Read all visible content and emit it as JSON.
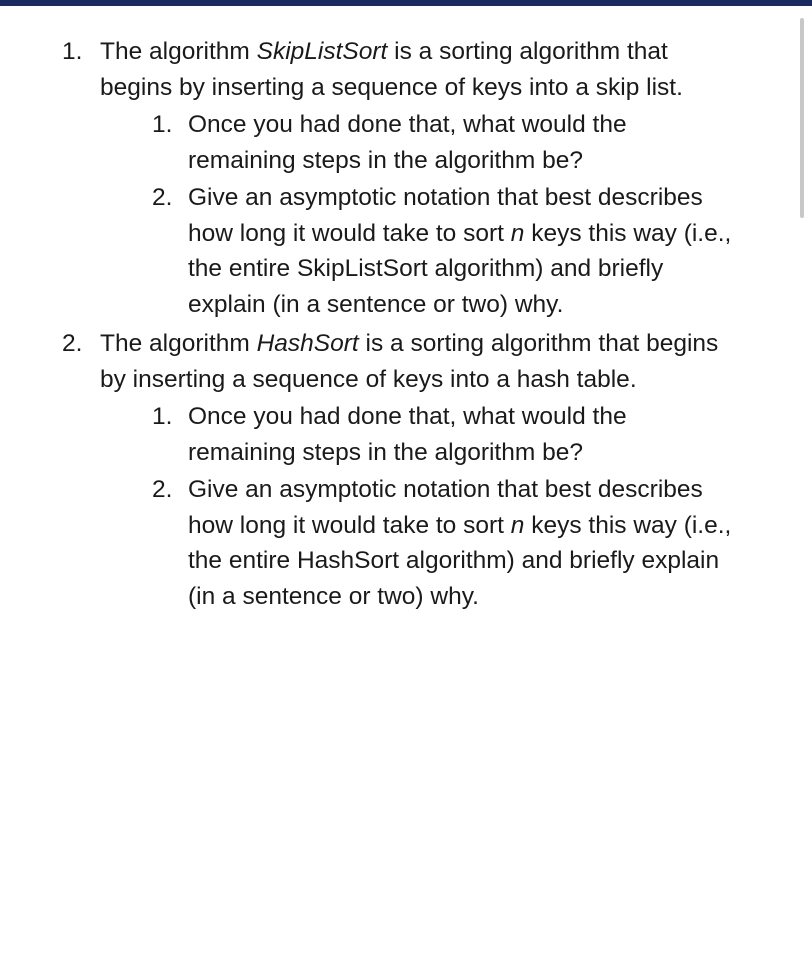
{
  "items": [
    {
      "intro_pre": "The algorithm ",
      "intro_italic": "SkipListSort",
      "intro_post": " is a sorting algorithm that begins by inserting a sequence of keys into a skip list.",
      "sub": [
        {
          "text": "Once you had done that, what would the remaining steps in the algorithm be?"
        },
        {
          "pre": "Give an asymptotic notation that best describes how long it would take to sort ",
          "var": "n",
          "post": " keys this way (i.e., the entire SkipListSort algorithm) and briefly explain (in a sentence or two) why."
        }
      ]
    },
    {
      "intro_pre": "The algorithm ",
      "intro_italic": "HashSort",
      "intro_post": " is a sorting algorithm that begins by inserting a sequence of keys into a hash table.",
      "sub": [
        {
          "text": "Once you had done that, what would the remaining steps in the algorithm be?"
        },
        {
          "pre": "Give an asymptotic notation that best describes how long it would take to sort ",
          "var": "n",
          "post": " keys this way (i.e., the entire HashSort algorithm) and briefly explain (in a sentence or two) why."
        }
      ]
    }
  ]
}
